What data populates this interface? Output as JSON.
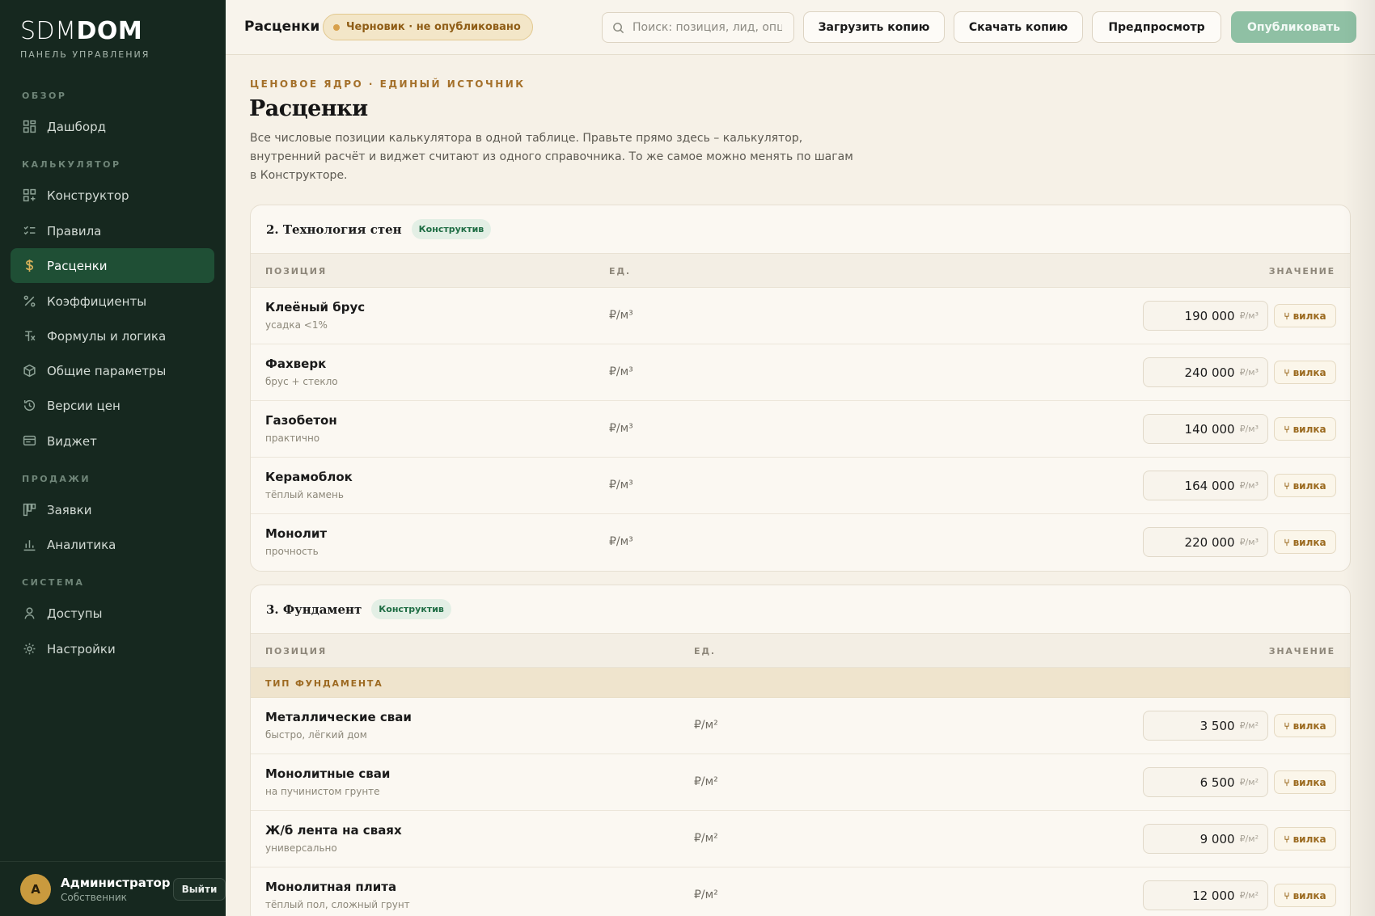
{
  "sidebar": {
    "brand_light": "SDM",
    "brand_bold": "DOM",
    "brand_sub": "ПАНЕЛЬ УПРАВЛЕНИЯ",
    "sections": {
      "overview": "ОБЗОР",
      "calculator": "КАЛЬКУЛЯТОР",
      "sales": "ПРОДАЖИ",
      "system": "СИСТЕМА"
    },
    "items": {
      "dashboard": "Дашборд",
      "constructor": "Конструктор",
      "rules": "Правила",
      "prices": "Расценки",
      "coefficients": "Коэффициенты",
      "formulas": "Формулы и логика",
      "params": "Общие параметры",
      "versions": "Версии цен",
      "widget": "Виджет",
      "requests": "Заявки",
      "analytics": "Аналитика",
      "access": "Доступы",
      "settings": "Настройки"
    },
    "user": {
      "initial": "А",
      "name": "Администратор",
      "role": "Собственник",
      "logout": "Выйти"
    }
  },
  "topbar": {
    "title": "Расценки",
    "status": "Черновик · не опубликовано",
    "search_placeholder": "Поиск: позиция, лид, опция",
    "upload": "Загрузить копию",
    "download": "Скачать копию",
    "preview": "Предпросмотр",
    "publish": "Опубликовать"
  },
  "header": {
    "eyebrow": "ЦЕНОВОЕ ЯДРО · ЕДИНЫЙ ИСТОЧНИК",
    "title": "Расценки",
    "description": "Все числовые позиции калькулятора в одной таблице. Правьте прямо здесь – калькулятор, внутренний расчёт и виджет считают из одного справочника. То же самое можно менять по шагам в Конструкторе."
  },
  "columns": {
    "position": "ПОЗИЦИЯ",
    "unit": "ЕД.",
    "value": "ЗНАЧЕНИЕ"
  },
  "range_label": "вилка",
  "walls": {
    "title": "2. Технология стен",
    "tag": "Конструктив",
    "rows": [
      {
        "name": "Клеёный брус",
        "sub": "усадка <1%",
        "unit": "₽/м³",
        "value": "190 000"
      },
      {
        "name": "Фахверк",
        "sub": "брус + стекло",
        "unit": "₽/м³",
        "value": "240 000"
      },
      {
        "name": "Газобетон",
        "sub": "практично",
        "unit": "₽/м³",
        "value": "140 000"
      },
      {
        "name": "Керамоблок",
        "sub": "тёплый камень",
        "unit": "₽/м³",
        "value": "164 000"
      },
      {
        "name": "Монолит",
        "sub": "прочность",
        "unit": "₽/м³",
        "value": "220 000"
      }
    ]
  },
  "foundation": {
    "title": "3. Фундамент",
    "tag": "Конструктив",
    "group": "ТИП ФУНДАМЕНТА",
    "rows": [
      {
        "name": "Металлические сваи",
        "sub": "быстро, лёгкий дом",
        "unit": "₽/м²",
        "value": "3 500"
      },
      {
        "name": "Монолитные сваи",
        "sub": "на пучинистом грунте",
        "unit": "₽/м²",
        "value": "6 500"
      },
      {
        "name": "Ж/б лента на сваях",
        "sub": "универсально",
        "unit": "₽/м²",
        "value": "9 000"
      },
      {
        "name": "Монолитная плита",
        "sub": "тёплый пол, сложный грунт",
        "unit": "₽/м²",
        "value": "12 000"
      }
    ]
  },
  "colors": {
    "sidebar_bg": "#16281f",
    "active_item": "#1f4f35",
    "accent_gold": "#a4702a",
    "publish_green": "#8fc0a4",
    "tag_green": "#1f6d44"
  }
}
